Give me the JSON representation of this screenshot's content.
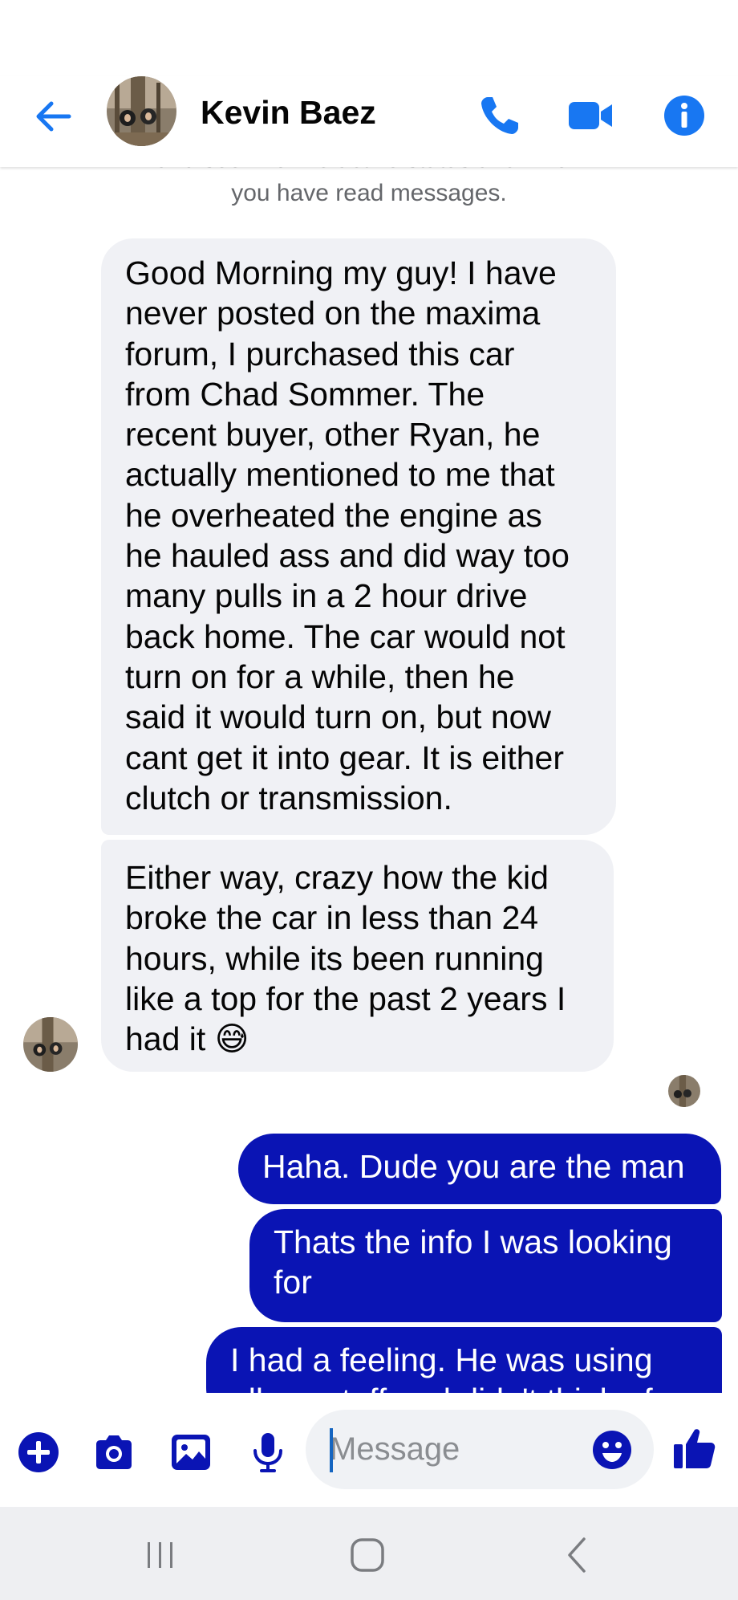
{
  "header": {
    "contact_name": "Kevin Baez",
    "icons": [
      "back-arrow-icon",
      "avatar",
      "phone-icon",
      "video-camera-icon",
      "info-icon"
    ]
  },
  "chat": {
    "privacy_note_line1": "and see info like active status and when",
    "privacy_note_line2": "you have read messages.",
    "incoming": [
      {
        "lines": [
          "Good Morning my guy! I have",
          "never posted on the maxima",
          "forum, I purchased this car",
          "from Chad Sommer. The",
          "recent buyer, other Ryan, he",
          "actually mentioned to me that",
          "he overheated the engine as",
          "he hauled ass and did way too",
          "many pulls in a 2 hour drive",
          "back home. The car would not",
          "turn on for a while, then he",
          "said it would turn on, but now",
          "cant get it into gear. It is either",
          "clutch or transmission."
        ]
      },
      {
        "lines": [
          "Either way, crazy how the kid",
          "broke the car in less than 24",
          "hours, while its been running",
          "like a top for the past 2 years I",
          "had it 😅"
        ]
      }
    ],
    "outgoing": [
      {
        "lines": [
          "Haha. Dude you are the man"
        ]
      },
      {
        "lines": [
          "Thats the info I was looking",
          "for"
        ]
      },
      {
        "lines": [
          "I had a feeling. He was using",
          "all my stuff and didn't think of"
        ]
      }
    ]
  },
  "composer": {
    "placeholder": "Message",
    "icons": [
      "add-icon",
      "camera-icon",
      "gallery-icon",
      "microphone-icon",
      "emoji-icon",
      "thumbs-up-icon"
    ]
  },
  "navbar": {
    "icons": [
      "recents-icon",
      "home-icon",
      "back-icon"
    ]
  },
  "colors": {
    "accent": "#1877f2",
    "outgoing_bubble": "#0a14b4",
    "incoming_bubble": "#f0f1f5"
  }
}
